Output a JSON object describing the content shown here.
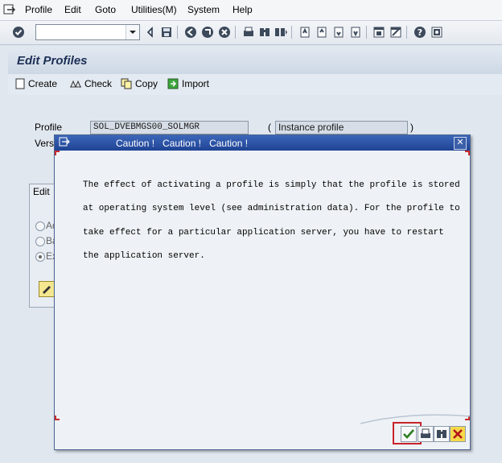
{
  "menubar": {
    "items": [
      "Profile",
      "Edit",
      "Goto",
      "Utilities(M)",
      "System",
      "Help"
    ]
  },
  "toolbar": {
    "command_field_value": "",
    "icons": [
      "enter-icon",
      "back-icon",
      "save-icon",
      "back-nav-icon",
      "exit-icon",
      "cancel-icon",
      "print-icon",
      "find-icon",
      "find-next-icon",
      "first-page-icon",
      "prev-page-icon",
      "next-page-icon",
      "last-page-icon",
      "create-session-icon",
      "shortcut-icon",
      "help-icon",
      "layout-icon"
    ]
  },
  "page": {
    "title": "Edit Profiles"
  },
  "app_toolbar": {
    "create_label": "Create",
    "check_label": "Check",
    "copy_label": "Copy",
    "import_label": "Import"
  },
  "form": {
    "profile_label": "Profile",
    "profile_value": "SOL_DVEBMGS00_SOLMGR",
    "profile_type_open": "(",
    "profile_type_value": "Instance profile",
    "profile_type_close": ")",
    "version_label": "Versi",
    "edit_group_label": "Edit",
    "radio_1_label": "Ad",
    "radio_2_label": "Ba",
    "radio_3_label": "Ex"
  },
  "dialog": {
    "title": "Caution !   Caution !   Caution !",
    "message_lines": [
      "The effect of activating a profile is simply that the profile is stored",
      "at operating system level (see administration data). For the profile to",
      "take effect for a particular application server, you have to restart",
      "the application server."
    ]
  },
  "colors": {
    "dialog_title_bar": "#2a4fa3",
    "highlight": "#c8232b",
    "accent_corner": "#cc2a2a"
  }
}
